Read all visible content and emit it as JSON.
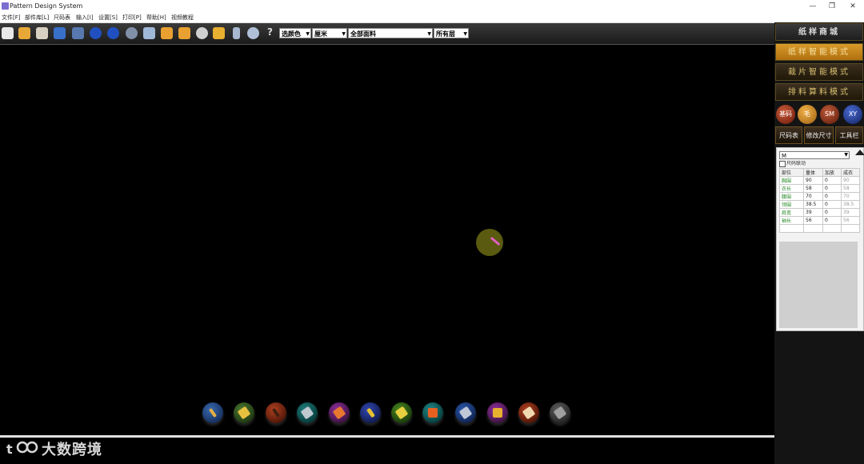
{
  "window": {
    "title": "Pattern Design System",
    "controls": [
      "—",
      "❐",
      "✕"
    ]
  },
  "menu": [
    "文件[F]",
    "部件库[L]",
    "尺码表",
    "输入[I]",
    "设置[S]",
    "打印[P]",
    "帮助[H]",
    "视频教程"
  ],
  "toolbar": {
    "help_glyph": "?",
    "combos": [
      {
        "value": "选颜色",
        "arrow": "▼"
      },
      {
        "value": "厘米",
        "arrow": "▼"
      },
      {
        "value": "全部面料",
        "arrow": "▼"
      },
      {
        "value": "所有层",
        "arrow": "▼"
      }
    ]
  },
  "right_panel": {
    "shop": "纸样商城",
    "modes": [
      "纸样智能模式",
      "裁片智能模式",
      "排料算料模式"
    ],
    "circles": [
      {
        "label": "基码",
        "color": "#a0381e"
      },
      {
        "label": "毛",
        "color": "#d8902a"
      },
      {
        "label": "SM",
        "color": "#a03a1e"
      },
      {
        "label": "XY",
        "color": "#2a4aa0"
      }
    ],
    "small_buttons": [
      "尺码表",
      "修改尺寸",
      "工具栏"
    ]
  },
  "size_panel": {
    "selected_size": "M",
    "checkbox_label": "尺码联动",
    "headers": [
      "部位",
      "量体",
      "加放",
      "成衣"
    ],
    "rows": [
      [
        "胸围",
        "90",
        "0",
        "90"
      ],
      [
        "衣长",
        "58",
        "0",
        "58"
      ],
      [
        "腰围",
        "70",
        "0",
        "70"
      ],
      [
        "领围",
        "38.5",
        "0",
        "38.5"
      ],
      [
        "肩宽",
        "39",
        "0",
        "39"
      ],
      [
        "袖长",
        "56",
        "0",
        "56"
      ]
    ]
  },
  "watermark": "大数跨境",
  "colors": {
    "accent": "#d89a2a",
    "canvas": "#000000",
    "panel": "#141414"
  }
}
